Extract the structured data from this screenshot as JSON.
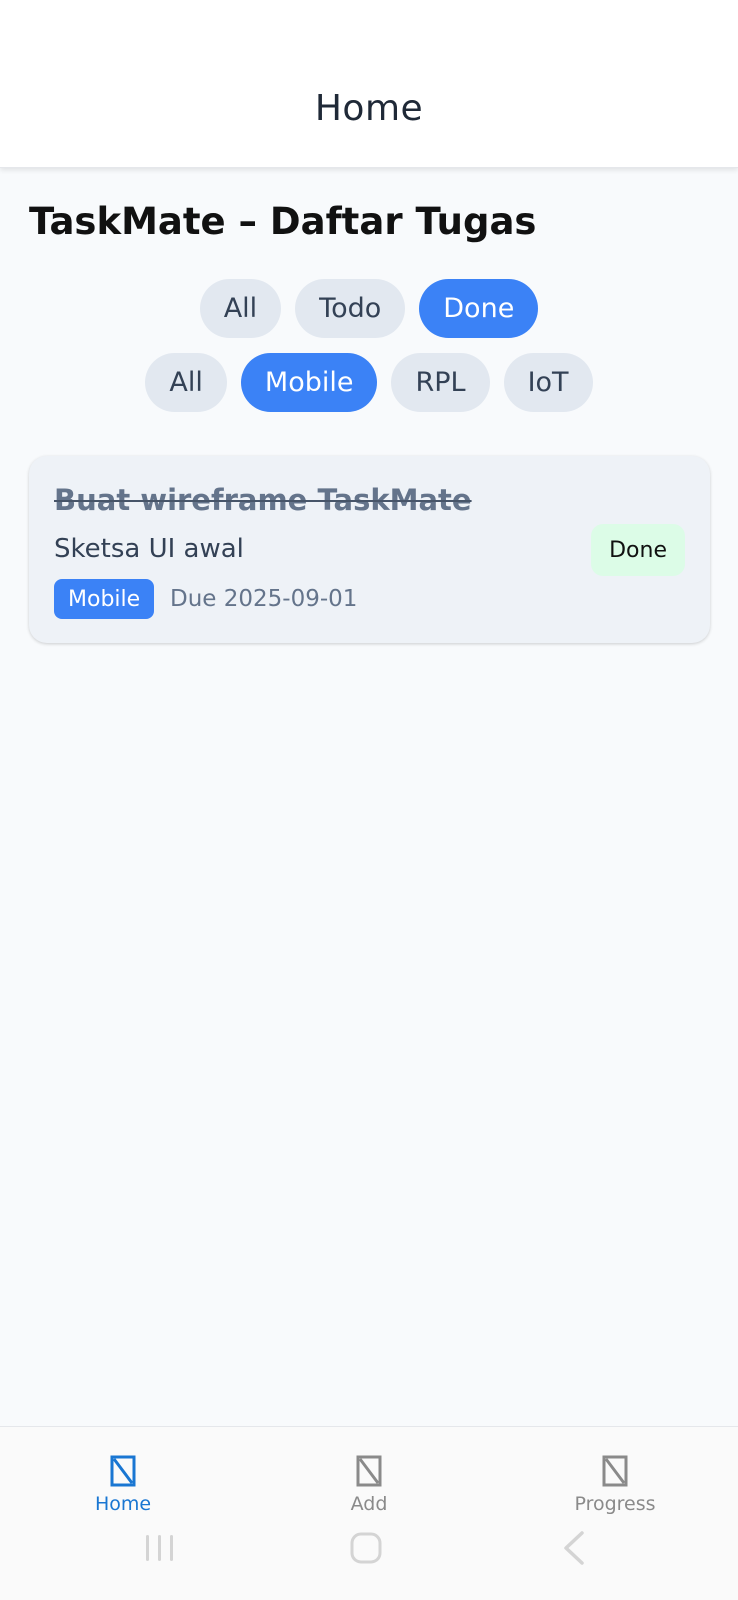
{
  "appbar": {
    "title": "Home"
  },
  "page": {
    "title": "TaskMate – Daftar Tugas"
  },
  "filters": {
    "status": [
      {
        "label": "All",
        "active": false
      },
      {
        "label": "Todo",
        "active": false
      },
      {
        "label": "Done",
        "active": true
      }
    ],
    "category": [
      {
        "label": "All",
        "active": false
      },
      {
        "label": "Mobile",
        "active": true
      },
      {
        "label": "RPL",
        "active": false
      },
      {
        "label": "IoT",
        "active": false
      }
    ]
  },
  "tasks": [
    {
      "title": "Buat wireframe TaskMate",
      "description": "Sketsa UI awal",
      "category": "Mobile",
      "due": "Due 2025-09-01",
      "status": "Done"
    }
  ],
  "nav": {
    "items": [
      {
        "label": "Home",
        "icon": "placeholder-icon",
        "active": true
      },
      {
        "label": "Add",
        "icon": "placeholder-icon",
        "active": false
      },
      {
        "label": "Progress",
        "icon": "placeholder-icon",
        "active": false
      }
    ]
  },
  "colors": {
    "accent": "#3b82f6",
    "nav_active": "#1976d2",
    "done_badge": "#dcfce7",
    "chip_inactive": "#e2e8f0"
  }
}
